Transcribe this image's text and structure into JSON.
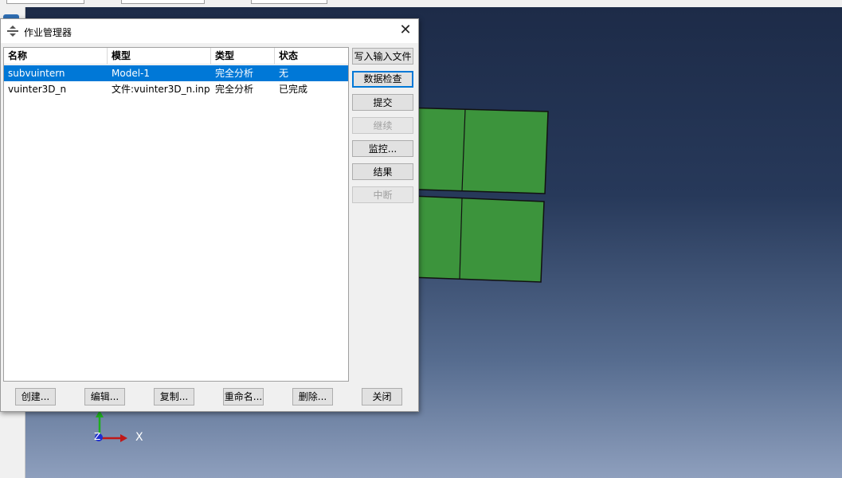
{
  "dialog": {
    "title": "作业管理器",
    "columns": [
      "名称",
      "模型",
      "类型",
      "状态"
    ],
    "rows": [
      {
        "name": "subvuintern",
        "model": "Model-1",
        "type": "完全分析",
        "status": "无"
      },
      {
        "name": "vuinter3D_n",
        "model": "文件:vuinter3D_n.inp",
        "type": "完全分析",
        "status": "已完成"
      }
    ],
    "side_buttons": {
      "write_input": "写入输入文件",
      "data_check": "数据检查",
      "submit": "提交",
      "continue": "继续",
      "monitor": "监控...",
      "results": "结果",
      "kill": "中断"
    },
    "bottom_buttons": {
      "create": "创建...",
      "edit": "编辑...",
      "copy": "复制...",
      "rename": "重命名...",
      "delete": "删除...",
      "close": "关闭"
    }
  },
  "triad": {
    "x_label": "X",
    "z_label": "Z"
  },
  "colors": {
    "selection": "#0078d7",
    "mesh_green": "#3c943c"
  }
}
